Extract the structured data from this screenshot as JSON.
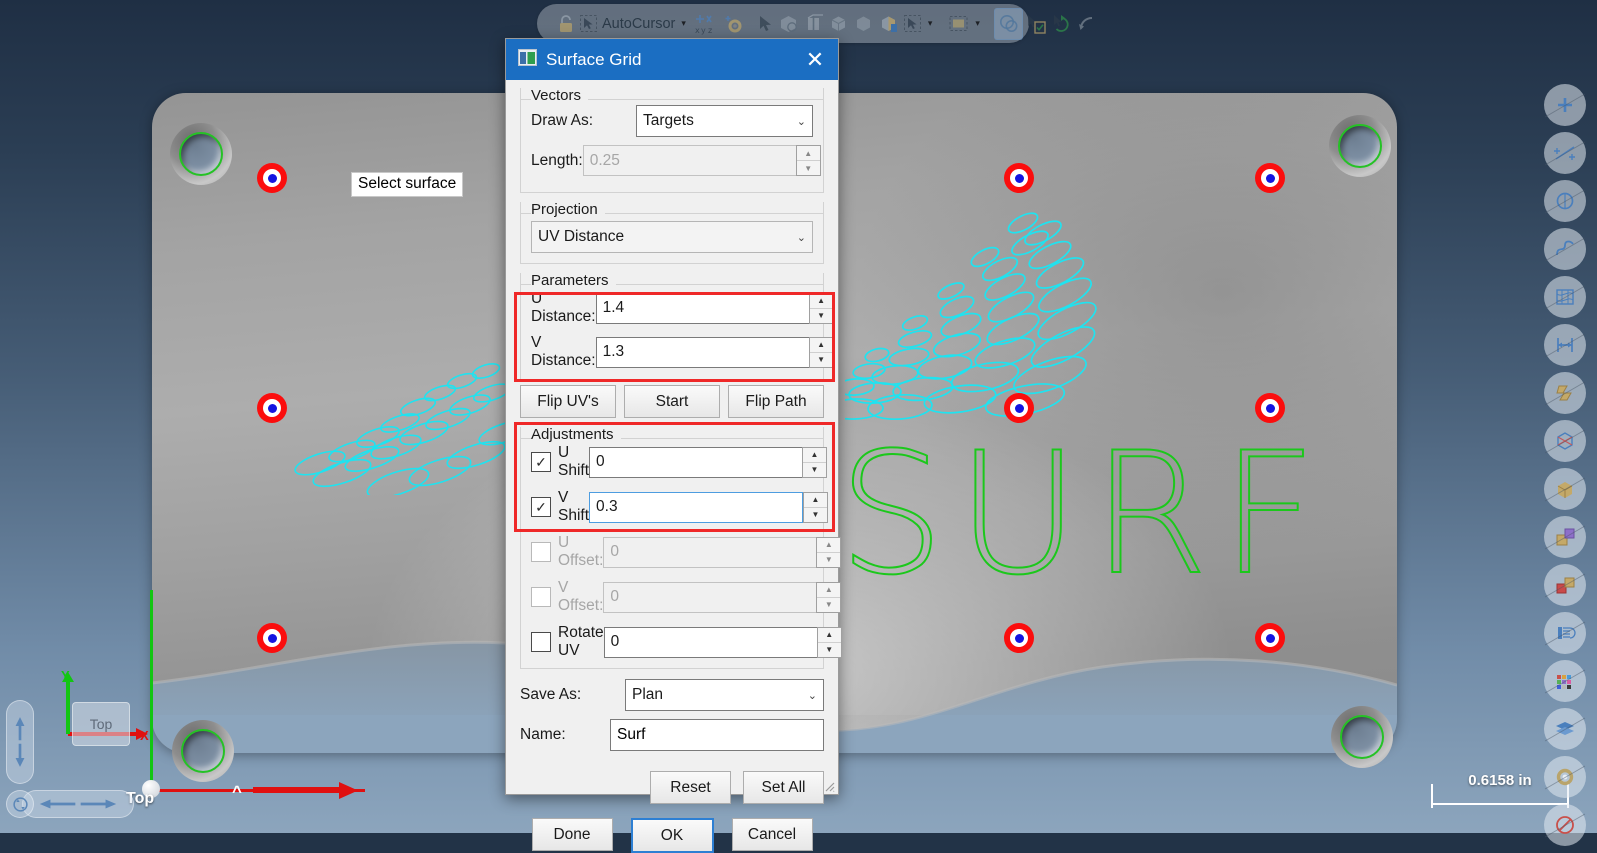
{
  "toolbar": {
    "lock_icon": "lock-icon",
    "autocursor_icon": "autocursor-icon",
    "autocursor_label": "AutoCursor",
    "dropdown_caret": "▾",
    "xyz_icon": "xyz-point-icon",
    "gear_icon": "gear-point-icon",
    "items": [
      {
        "name": "select-arrow-icon",
        "glyph": "arrow"
      },
      {
        "name": "select-face-icon",
        "glyph": "face"
      },
      {
        "name": "select-edge-icon",
        "glyph": "edge"
      },
      {
        "name": "select-solid-icon",
        "glyph": "solid"
      },
      {
        "name": "select-body-icon",
        "glyph": "body"
      },
      {
        "name": "select-partial-icon",
        "glyph": "partial"
      },
      {
        "name": "select-all-icon",
        "glyph": "selall"
      },
      {
        "name": "select-all-caret-icon",
        "glyph": "caret"
      },
      {
        "name": "selection-window-icon",
        "glyph": "window"
      },
      {
        "name": "selection-window-caret-icon",
        "glyph": "caret"
      },
      {
        "name": "entity-select-icon",
        "glyph": "entity"
      },
      {
        "name": "verify-select-icon",
        "glyph": "verify"
      },
      {
        "name": "rotate-select-icon",
        "glyph": "rotate"
      },
      {
        "name": "undo-select-icon",
        "glyph": "undo"
      }
    ]
  },
  "viewport": {
    "tooltip": "Select surface",
    "surf_text": "SURF",
    "gnomon": {
      "x_label": "X",
      "y_label": "Y",
      "cube_label": "Top"
    },
    "view_label": "Top",
    "scale_label": "0.6158 in",
    "targets_count": 9,
    "holes_count": 4
  },
  "right_sidebar": {
    "items": [
      {
        "name": "add-point-icon"
      },
      {
        "name": "add-line-icon"
      },
      {
        "name": "circle-icon"
      },
      {
        "name": "spline-icon"
      },
      {
        "name": "surface-icon"
      },
      {
        "name": "dimension-icon"
      },
      {
        "name": "ribbon-icon"
      },
      {
        "name": "solid-model-icon"
      },
      {
        "name": "box-icon"
      },
      {
        "name": "transform-icon"
      },
      {
        "name": "position-icon"
      },
      {
        "name": "levels-icon"
      },
      {
        "name": "colors-icon"
      },
      {
        "name": "layers-icon"
      },
      {
        "name": "settings-gear-icon"
      },
      {
        "name": "no-entry-icon"
      }
    ]
  },
  "dialog": {
    "icon": "surface-grid-icon",
    "title": "Surface Grid",
    "close_label": "✕",
    "vectors": {
      "legend": "Vectors",
      "draw_as_label": "Draw As:",
      "draw_as_value": "Targets",
      "draw_as_options": [
        "Targets"
      ],
      "length_label": "Length:",
      "length_value": "0.25",
      "length_enabled": false
    },
    "projection": {
      "legend": "Projection",
      "value": "UV Distance",
      "options": [
        "UV Distance"
      ]
    },
    "parameters": {
      "legend": "Parameters",
      "u_distance_label": "U Distance:",
      "u_distance_value": "1.4",
      "v_distance_label": "V Distance:",
      "v_distance_value": "1.3",
      "highlighted": true,
      "highlight_color": "#ef2828"
    },
    "uv_buttons": {
      "flip_uvs": "Flip UV's",
      "start": "Start",
      "flip_path": "Flip Path"
    },
    "adjustments": {
      "legend": "Adjustments",
      "highlighted": true,
      "highlight_color": "#ef2828",
      "rows": [
        {
          "label": "U Shift",
          "value": "0",
          "checked": true,
          "enabled": true,
          "focused": false
        },
        {
          "label": "V Shift",
          "value": "0.3",
          "checked": true,
          "enabled": true,
          "focused": true
        },
        {
          "label": "U Offset:",
          "value": "0",
          "checked": false,
          "enabled": false,
          "focused": false
        },
        {
          "label": "V Offset:",
          "value": "0",
          "checked": false,
          "enabled": false,
          "focused": false
        },
        {
          "label": "Rotate UV",
          "value": "0",
          "checked": false,
          "enabled": true,
          "focused": false
        }
      ]
    },
    "save": {
      "save_as_label": "Save As:",
      "save_as_value": "Plan",
      "save_as_options": [
        "Plan"
      ],
      "name_label": "Name:",
      "name_value": "Surf"
    },
    "buttons": {
      "reset": "Reset",
      "set_all": "Set All",
      "done": "Done",
      "ok": "OK",
      "cancel": "Cancel"
    }
  },
  "colors": {
    "title_bar": "#1b6ec2",
    "highlight": "#ef2828",
    "target_outer": "#fb0d0d",
    "target_inner": "#1414e0",
    "toolpath_cyan": "#1fe3f0",
    "geometry_green": "#1bc81b",
    "axis_x": "#e01010",
    "axis_y": "#12c612"
  }
}
